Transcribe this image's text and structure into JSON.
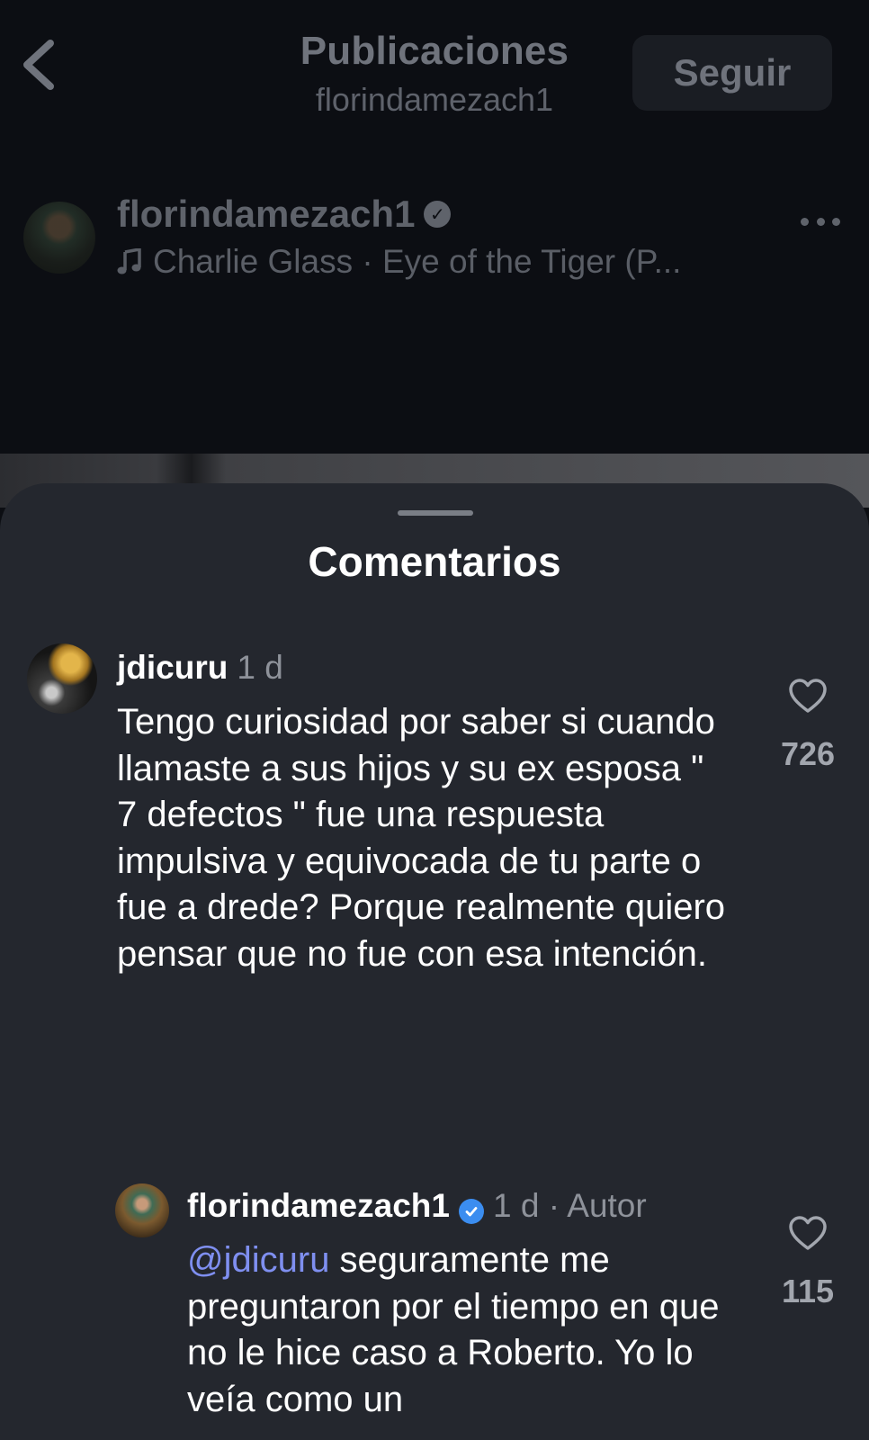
{
  "header": {
    "title": "Publicaciones",
    "subtitle": "florindamezach1",
    "follow_label": "Seguir",
    "back_icon": "chevron-left-icon"
  },
  "post": {
    "username": "florindamezach1",
    "music": "Charlie Glass · Eye of the Tiger (P...",
    "music_icon": "music-note-icon",
    "more_icon": "more-horizontal-icon"
  },
  "sheet": {
    "title": "Comentarios"
  },
  "comments": [
    {
      "username": "jdicuru",
      "time": "1 d",
      "text": "Tengo curiosidad por saber si cuando llamaste a sus hijos y su ex esposa \" 7 defectos \" fue una respuesta impulsiva y equivocada de tu parte o fue a drede? Porque realmente quiero pensar que no fue con esa intención.",
      "likes": "726"
    },
    {
      "username": "florindamezach1",
      "meta": "1 d · Autor",
      "mention": "@jdicuru",
      "text": " seguramente me preguntaron por el tiempo en que no le hice caso a Roberto. Yo lo veía como un",
      "likes": "115"
    }
  ],
  "colors": {
    "sheet_bg": "#24272e",
    "page_bg": "#0c0e13",
    "mention": "#7f8ff0",
    "verified": "#3b8df0"
  }
}
